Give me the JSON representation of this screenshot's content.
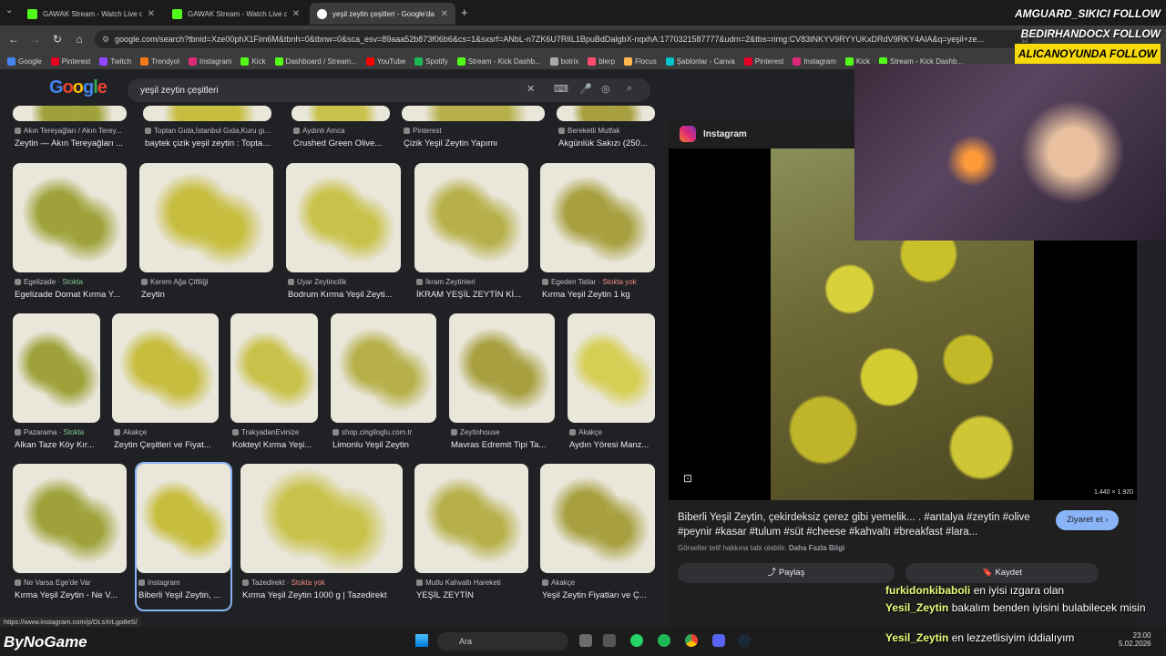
{
  "tabs": [
    {
      "label": "GAWAK Stream - Watch Live on",
      "color": "#53fc18"
    },
    {
      "label": "GAWAK Stream - Watch Live on",
      "color": "#53fc18"
    },
    {
      "label": "yeşil zeytin çeşitleri - Google'da",
      "color": "#4285f4"
    }
  ],
  "address": "google.com/search?tbnid=Xze00phX1Fim6M&tbnh=0&tbnw=0&sca_esv=89aaa52b873f06b6&cs=1&sxsrf=ANbL-n7ZK6U7RlIL1BpuBdDalgbX-nqxhA:1770321587777&udm=2&tbs=rimg:CV83tNKYV9RYYUKxDRdV9RKY4AIA&q=yeşil+ze...",
  "bookmarks": [
    {
      "label": "Google",
      "color": "#4285f4"
    },
    {
      "label": "Pinterest",
      "color": "#e60023"
    },
    {
      "label": "Twitch",
      "color": "#9146ff"
    },
    {
      "label": "Trendyol",
      "color": "#f27a1a"
    },
    {
      "label": "Instagram",
      "color": "#dd2a7b"
    },
    {
      "label": "Kick",
      "color": "#53fc18"
    },
    {
      "label": "Dashboard / Stream...",
      "color": "#53fc18"
    },
    {
      "label": "YouTube",
      "color": "#ff0000"
    },
    {
      "label": "Spotify",
      "color": "#1db954"
    },
    {
      "label": "Stream - Kick Dashb...",
      "color": "#53fc18"
    },
    {
      "label": "botrix",
      "color": "#aaaaaa"
    },
    {
      "label": "blerp",
      "color": "#ff4b6e"
    },
    {
      "label": "Flocus",
      "color": "#ffb74d"
    },
    {
      "label": "Şablonlar - Canva",
      "color": "#00c4cc"
    },
    {
      "label": "Pinterest",
      "color": "#e60023"
    },
    {
      "label": "Instagram",
      "color": "#dd2a7b"
    },
    {
      "label": "Kick",
      "color": "#53fc18"
    },
    {
      "label": "Stream - Kick Dashb...",
      "color": "#53fc18"
    }
  ],
  "search": {
    "query": "yeşil zeytin çeşitleri"
  },
  "results": {
    "row0": [
      {
        "src": "Akın Tereyağları / Akın Terey...",
        "title": "Zeytin — Akın Tereyağları ..."
      },
      {
        "src": "Toptan Gıda,İstanbul Gıda,Kuru gı...",
        "title": "baytek çizik yeşil zeytin : Toptan..."
      },
      {
        "src": "Aydınlı Amca",
        "title": "Crushed Green Olive..."
      },
      {
        "src": "Pinterest",
        "title": "Çizik Yeşil Zeytin Yapımı"
      },
      {
        "src": "Bereketli Mutfak",
        "title": "Akgünlük Sakızı (250..."
      }
    ],
    "row1": [
      {
        "src": "Egelizade",
        "stock": "Stokta",
        "title": "Egelizade Domat Kırma Y..."
      },
      {
        "src": "Kerem Ağa Çiftliği",
        "title": "Zeytin"
      },
      {
        "src": "Uyar Zeytincilik",
        "title": "Bodrum Kırma Yeşil Zeyti..."
      },
      {
        "src": "İkram Zeytinleri",
        "title": "İKRAM YEŞİL ZEYTİN Kİ..."
      },
      {
        "src": "Egeden Tatlar",
        "nostock": "Stokta yok",
        "title": "Kırma Yeşil Zeytin 1 kg"
      }
    ],
    "row2": [
      {
        "src": "Pazarama",
        "stock": "Stokta",
        "title": "Alkan Taze Köy Kır..."
      },
      {
        "src": "Akakçe",
        "title": "Zeytin Çeşitleri ve Fiyat..."
      },
      {
        "src": "TrakyadanEvinize",
        "title": "Kokteyl Kırma Yeşi..."
      },
      {
        "src": "shop.cingiloglu.com.tr",
        "title": "Limonlu Yeşil Zeytin"
      },
      {
        "src": "Zeytinhouse",
        "title": "Mavras Edremit Tipi Ta..."
      },
      {
        "src": "Akakçe",
        "title": "Aydın Yöresi Manz..."
      }
    ],
    "row3": [
      {
        "src": "Ne Varsa Ege'de Var",
        "title": "Kırma Yeşil Zeytin - Ne V..."
      },
      {
        "src": "Instagram",
        "title": "Biberli Yeşil Zeytin, ..."
      },
      {
        "src": "Tazedirekt",
        "nostock": "Stokta yok",
        "title": "Kırma Yeşil Zeytin 1000 g | Tazedirekt"
      },
      {
        "src": "Mutlu Kahvaltı Hareketi",
        "title": "YEŞİL ZEYTİN"
      },
      {
        "src": "Akakçe",
        "title": "Yeşil Zeytin Fiyatları ve Ç..."
      }
    ]
  },
  "panel": {
    "source": "Instagram",
    "size": "1.440 × 1.920",
    "description": "Biberli Yeşil Zeytin, çekirdeksiz çerez gibi yemelik... . #antalya #zeytin #olive #peynir #kasar #tulum #süt #cheese #kahvaltı #breakfast #lara...",
    "visit": "Ziyaret et",
    "copyright": "Görseller telif hakkına tabi olabilir.",
    "more": "Daha Fazla Bilgi",
    "share": "Paylaş",
    "save": "Kaydet"
  },
  "stream": {
    "names": [
      "AMGUARD_SIKICI",
      "BEDIRHANDOCX",
      "ALICANOYUNDA"
    ],
    "follow": "FOLLOW",
    "logo": "ByNoGame"
  },
  "chat": [
    {
      "user": "furkidonkibaboli",
      "msg": "en iyisi ızgara olan"
    },
    {
      "user": "Yesil_Zeytin",
      "msg": "bakalım benden iyisini bulabilecek misin"
    },
    {
      "user": "Yesil_Zeytin",
      "msg": "en lezzetlisiyim iddialıyım"
    }
  ],
  "status_url": "https://www.instagram.com/p/DLsXrLgo8eS/",
  "taskbar": {
    "search": "Ara",
    "time": "23:00",
    "date": "5.02.2026"
  }
}
